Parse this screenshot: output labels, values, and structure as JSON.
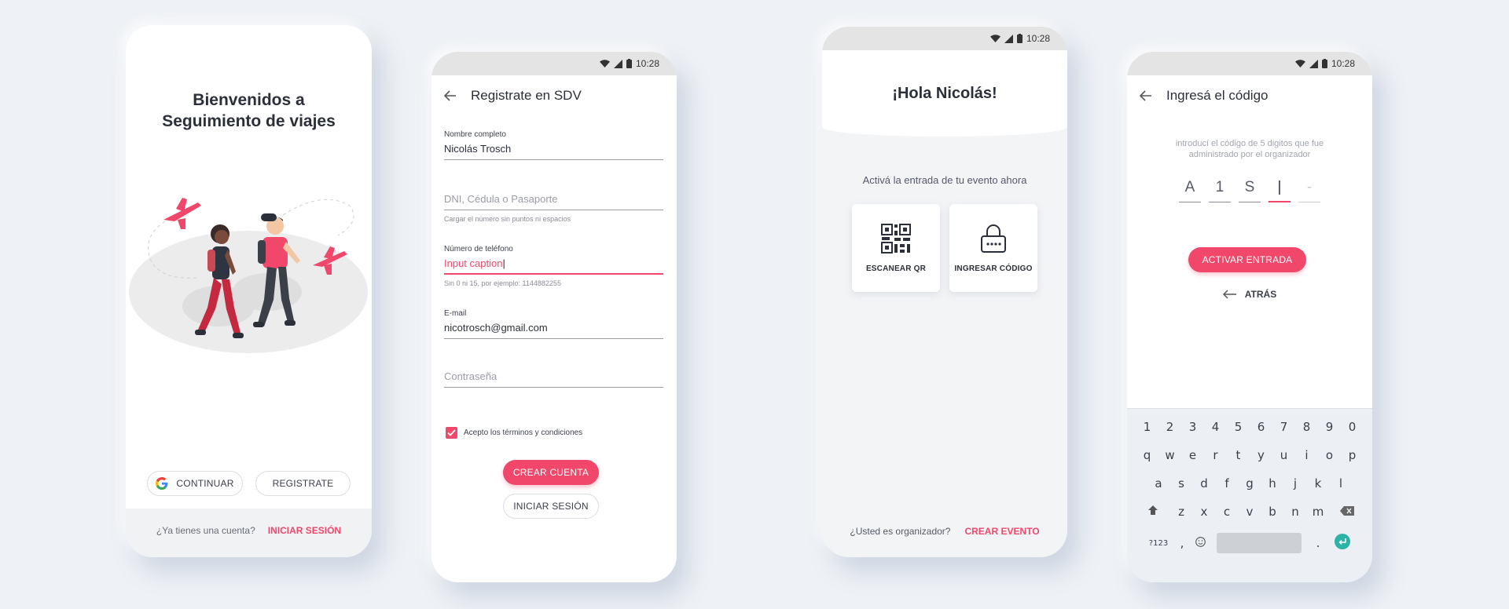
{
  "status": {
    "time": "10:28"
  },
  "colors": {
    "accent": "#f0476a",
    "background": "#eef1f5"
  },
  "screen1": {
    "title_line1": "Bienvenidos a",
    "title_line2": "Seguimiento de viajes",
    "continue_label": "CONTINUAR",
    "register_label": "REGISTRATE",
    "have_account": "¿Ya tienes una cuenta?",
    "login_link": "INICIAR SESIÓN"
  },
  "screen2": {
    "title": "Registrate en SDV",
    "fields": [
      {
        "label": "Nombre completo",
        "value": "Nicolás Trosch"
      },
      {
        "label": "",
        "placeholder": "DNI, Cédula o Pasaporte",
        "help": "Cargar el número sin puntos ni espacios"
      },
      {
        "label": "Número de teléfono",
        "value": "Input caption",
        "help": "Sin 0 ni 15, por ejemplo: 1144882255"
      },
      {
        "label": "E-mail",
        "value": "nicotrosch@gmail.com"
      },
      {
        "label": "",
        "placeholder": "Contraseña"
      }
    ],
    "terms_label": "Acepto los términos y condiciones",
    "terms_checked": true,
    "create_button": "CREAR CUENTA",
    "login_button": "INICIAR SESIÓN"
  },
  "screen3": {
    "greeting": "¡Hola Nicolás!",
    "subtitle": "Activá la entrada de tu evento ahora",
    "scan_label": "ESCANEAR QR",
    "code_label": "INGRESAR CÓDIGO",
    "organizer_question": "¿Usted es organizador?",
    "create_event_link": "CREAR EVENTO"
  },
  "screen4": {
    "title": "Ingresá el código",
    "instruction": "introducí el código de 5 digitos que fue administrado por el organizador",
    "code_chars": [
      "A",
      "1",
      "S",
      "|",
      "-"
    ],
    "activate_button": "ACTIVAR ENTRADA",
    "back_label": "ATRÁS",
    "keyboard": {
      "row1": [
        "1",
        "2",
        "3",
        "4",
        "5",
        "6",
        "7",
        "8",
        "9",
        "0"
      ],
      "row2": [
        "q",
        "w",
        "e",
        "r",
        "t",
        "y",
        "u",
        "i",
        "o",
        "p"
      ],
      "row3": [
        "a",
        "s",
        "d",
        "f",
        "g",
        "h",
        "j",
        "k",
        "l"
      ],
      "row4": [
        "z",
        "x",
        "c",
        "v",
        "b",
        "n",
        "m"
      ],
      "symbols_key": "?123",
      "comma_key": ",",
      "period_key": "."
    }
  }
}
